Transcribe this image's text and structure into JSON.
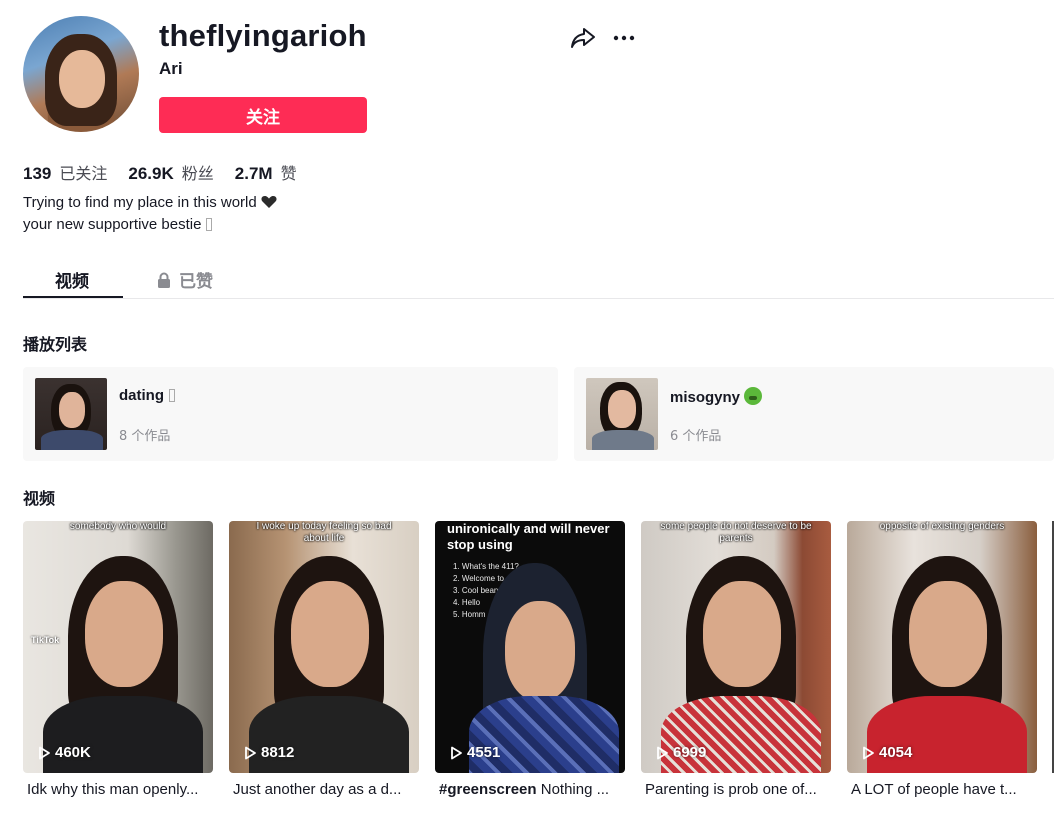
{
  "profile": {
    "username": "theflyingarioh",
    "nickname": "Ari",
    "follow_label": "关注"
  },
  "stats": [
    {
      "value": "139",
      "label": "已关注"
    },
    {
      "value": "26.9K",
      "label": "粉丝"
    },
    {
      "value": "2.7M",
      "label": "赞"
    }
  ],
  "bio": {
    "line1": "Trying to find my place in this world",
    "line2": "your new supportive bestie"
  },
  "tabs": {
    "videos": "视频",
    "liked": "已赞"
  },
  "sections": {
    "playlists": "播放列表",
    "videos": "视频"
  },
  "playlists": [
    {
      "name": "dating",
      "count": "8 个作品"
    },
    {
      "name": "misogyny",
      "count": "6 个作品"
    }
  ],
  "videos": [
    {
      "views": "460K",
      "title": "Idk why this man openly...",
      "overlay": "somebody who would",
      "watermark": "TikTok"
    },
    {
      "views": "8812",
      "title": "Just another day as a d...",
      "overlay": "I woke up today feeling so bad about life"
    },
    {
      "views": "4551",
      "title_hashtag": "#greenscreen",
      "title_rest": " Nothing ...",
      "overlay": "unironically and will never stop using",
      "list": [
        "1. What's the 411?",
        "2. Welcome to",
        "3. Cool beans",
        "4. Hello",
        "5. Homm"
      ]
    },
    {
      "views": "6999",
      "title": "Parenting is prob one of...",
      "overlay": "some people do not deserve to be parents"
    },
    {
      "views": "4054",
      "title": "A LOT of people have t...",
      "overlay": "opposite of existing genders"
    }
  ],
  "colors": {
    "accent": "#fe2c55",
    "text": "#161823",
    "muted": "#8a8b91",
    "card_bg": "#f8f8f8"
  }
}
